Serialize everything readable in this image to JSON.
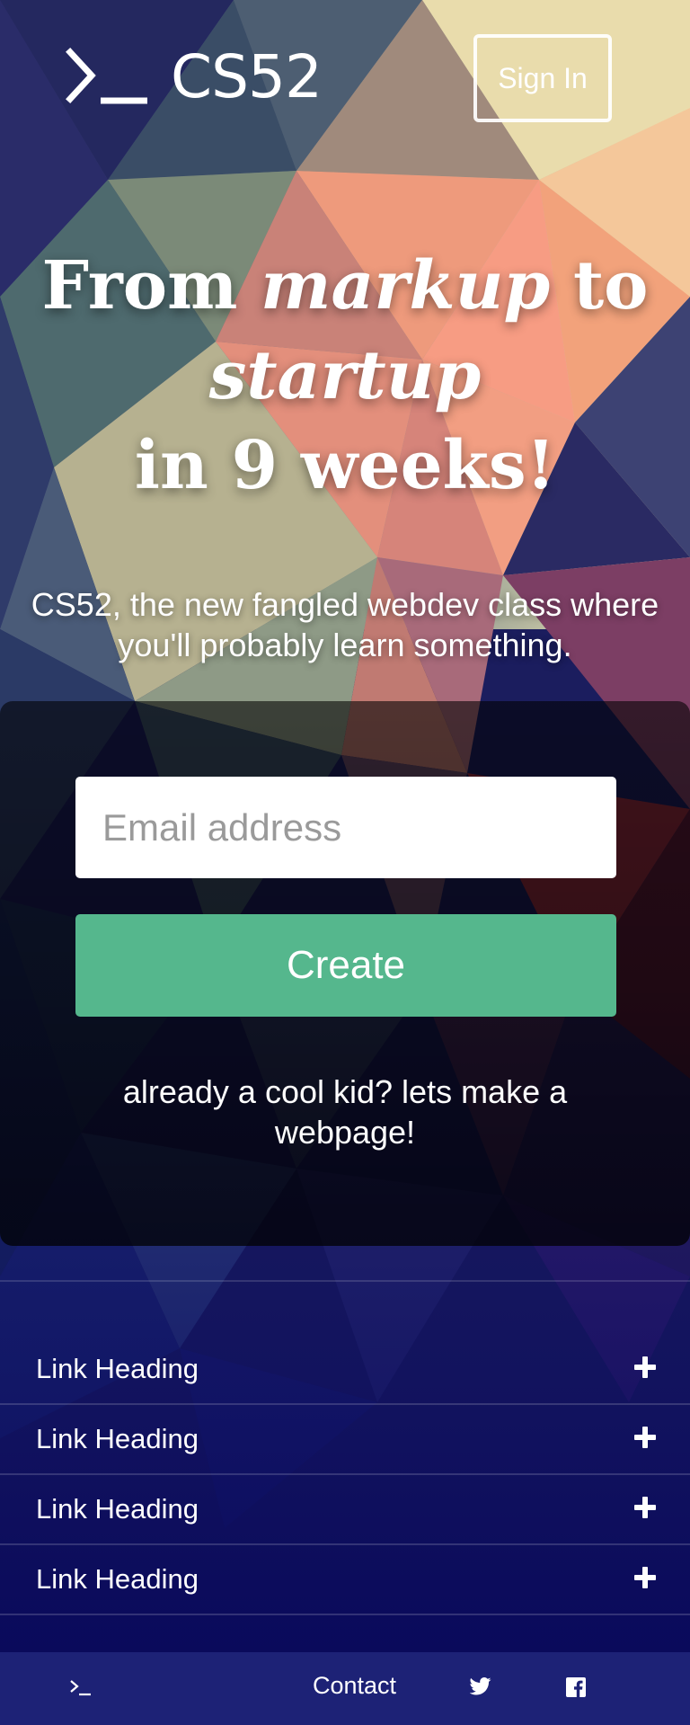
{
  "header": {
    "brand": "CS52",
    "signin_label": "Sign In"
  },
  "hero": {
    "title_part1": "From ",
    "title_emph1": "markup",
    "title_part2": " to",
    "title_emph2": "startup",
    "title_part3": "in 9 weeks!",
    "subtitle": "CS52, the new fangled webdev class where you'll probably learn something."
  },
  "signup": {
    "email_placeholder": "Email address",
    "create_label": "Create",
    "existing_text": "already a cool kid? lets make a webpage!"
  },
  "links": [
    {
      "label": "Link Heading"
    },
    {
      "label": "Link Heading"
    },
    {
      "label": "Link Heading"
    },
    {
      "label": "Link Heading"
    }
  ],
  "footer": {
    "contact_label": "Contact"
  },
  "colors": {
    "accent_green": "#55b78d",
    "footer_blue": "#1d2276",
    "deep_blue": "#0a0a5e"
  }
}
